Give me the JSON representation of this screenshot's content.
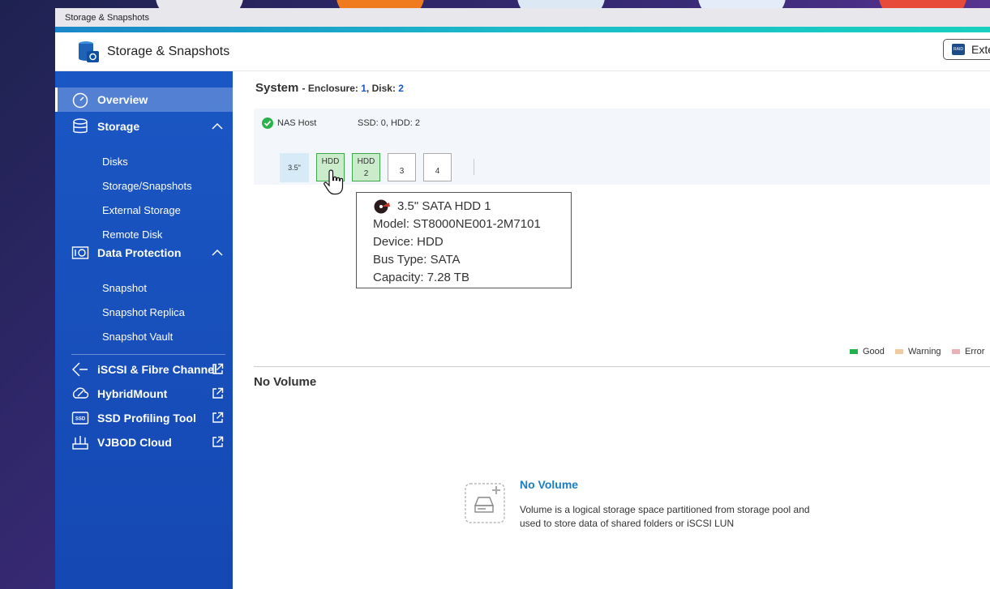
{
  "window": {
    "title": "Storage & Snapshots"
  },
  "header": {
    "app_title": "Storage & Snapshots",
    "external_button_label": "Exte"
  },
  "sidebar": {
    "overview": "Overview",
    "storage": "Storage",
    "storage_items": [
      "Disks",
      "Storage/Snapshots",
      "External Storage",
      "Remote Disk"
    ],
    "data_protection": "Data Protection",
    "data_protection_items": [
      "Snapshot",
      "Snapshot Replica",
      "Snapshot Vault"
    ],
    "links": [
      "iSCSI & Fibre Channel",
      "HybridMount",
      "SSD Profiling Tool",
      "VJBOD Cloud"
    ]
  },
  "system": {
    "title": "System",
    "meta_prefix": "- Enclosure: ",
    "enclosure": "1",
    "meta_mid": ", Disk: ",
    "disk": "2",
    "host_name": "NAS Host",
    "host_disks": "SSD: 0, HDD: 2",
    "size_label": "3.5\"",
    "slots": [
      {
        "type": "HDD",
        "num": "1",
        "status": "good"
      },
      {
        "type": "HDD",
        "num": "2",
        "status": "good"
      },
      {
        "type": "",
        "num": "3",
        "status": "empty"
      },
      {
        "type": "",
        "num": "4",
        "status": "empty"
      }
    ]
  },
  "tooltip": {
    "title": "3.5\" SATA HDD 1",
    "model": "Model: ST8000NE001-2M7101",
    "device": "Device: HDD",
    "bus": "Bus Type: SATA",
    "capacity": "Capacity: 7.28 TB"
  },
  "legend": [
    {
      "label": "Good",
      "color": "#22b14c"
    },
    {
      "label": "Warning",
      "color": "#f3c9a0"
    },
    {
      "label": "Error",
      "color": "#eab0b8"
    }
  ],
  "volume": {
    "section_title": "No Volume",
    "empty_title": "No Volume",
    "empty_desc": "Volume is a logical storage space partitioned from storage pool and used to store data of shared folders or iSCSI LUN"
  }
}
